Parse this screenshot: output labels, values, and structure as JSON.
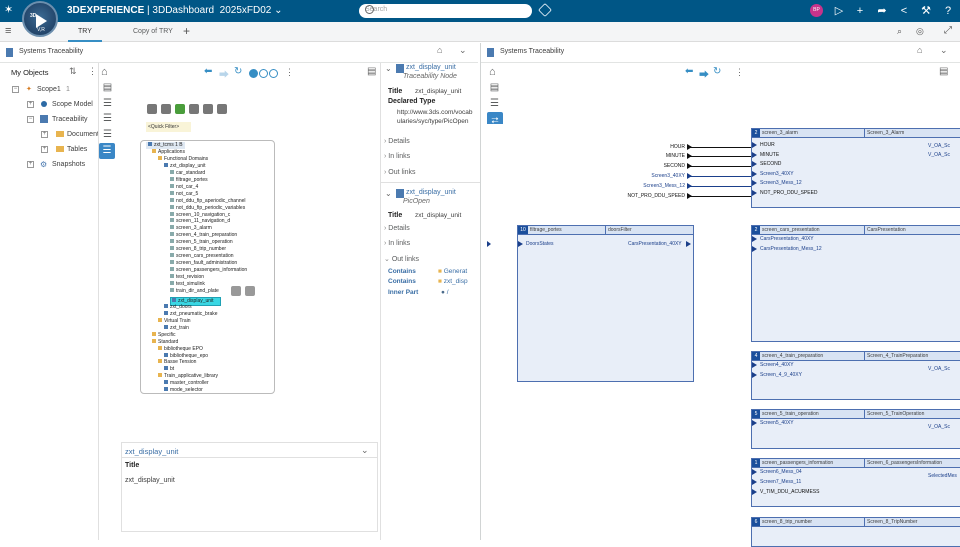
{
  "app": {
    "brand_bold": "3DEXPERIENCE",
    "brand_rest": " | 3DDashboard",
    "dashboard_name": "2025xFD02",
    "compass_label": "3D",
    "compass_version": "V,R",
    "search_placeholder": "Search",
    "avatar_initials": "BP"
  },
  "tabs": [
    "TRY",
    "Copy of TRY"
  ],
  "left_panel": {
    "title": "Systems Traceability",
    "my_objects": "My Objects",
    "scope": "Scope1",
    "scope_count": "1",
    "scope_items": [
      "Scope Model",
      "Traceability"
    ],
    "traceability_children": [
      "Documents",
      "Tables"
    ],
    "snapshots": "Snapshots",
    "quick_filter": "<Quick Filter>",
    "tree_nodes": [
      "zxt_tcms 1 B",
      "Applications",
      "Functional Domains",
      "zxt_display_unit",
      "car_standard",
      "filtrage_portes",
      "not_car_4",
      "not_car_5",
      "not_ddu_fip_aperiodic_channel",
      "not_ddu_fip_periodic_variables",
      "screen_10_navigation_c",
      "screen_11_navigation_d",
      "screen_3_alarm",
      "screen_4_train_preparation",
      "screen_5_train_operation",
      "screen_8_trip_number",
      "screen_cars_presentation",
      "screen_fault_administration",
      "screen_passengers_information",
      "test_revision",
      "test_simulink",
      "train_dir_and_plate",
      "zxt_display_unit",
      "zxt_doors",
      "zxt_pneumatic_brake",
      "Virtual Train",
      "zxt_train",
      "Specific",
      "Standard",
      "bibliotheque EPO",
      "bibliotheque_epo",
      "Basse Tension",
      "bt",
      "Train_applicative_library",
      "master_controller",
      "mode_selector"
    ],
    "bottom_title": "zxt_display_unit",
    "bottom_field": "Title",
    "bottom_value": "zxt_display_unit"
  },
  "details": {
    "card1_name": "zxt_display_unit",
    "card1_type": "Traceability Node",
    "title_label": "Title",
    "title_value": "zxt_display_unit",
    "declared_type_label": "Declared Type",
    "declared_type_value": "http://www.3ds.com/vocabularies/syc/type/PicOpen",
    "sections": [
      "Details",
      "In links",
      "Out links"
    ],
    "card2_name": "zxt_display_unit",
    "card2_type": "PicOpen",
    "card2_title_label": "Title",
    "card2_title_value": "zxt_display_unit",
    "out_links": [
      {
        "rel": "Contains",
        "target": "Generat"
      },
      {
        "rel": "Contains",
        "target": "zxt_disp"
      },
      {
        "rel": "Inner Part",
        "target": "/"
      }
    ]
  },
  "right_panel": {
    "title": "Systems Traceability",
    "input_signals": [
      "HOUR",
      "MINUTE",
      "SECOND",
      "Screen3_40XY",
      "Screen3_Mess_12",
      "NOT_PRO_DDU_SPEED"
    ],
    "blocks": [
      {
        "num": "2",
        "name": "screen_3_alarm",
        "type": "Screen_3_Alarm",
        "inputs": [
          "HOUR",
          "MINUTE",
          "SECOND",
          "Screen3_40XY",
          "Screen3_Mess_12",
          "NOT_PRO_DDU_SPEED"
        ],
        "outputs": [
          "V_OA_Sc",
          "V_OA_Sc"
        ]
      },
      {
        "num": "2",
        "name": "screen_cars_presentation",
        "type": "CarsPresentation",
        "inputs": [
          "CarsPresentation_40XY",
          "CarsPresentation_Mess_12"
        ],
        "outputs": []
      },
      {
        "num": "4",
        "name": "screen_4_train_preparation",
        "type": "Screen_4_TrainPreparation",
        "inputs": [
          "Screen4_40XY",
          "Screen_4_9_40XY"
        ],
        "outputs": [
          "V_OA_Sc"
        ]
      },
      {
        "num": "5",
        "name": "screen_5_train_operation",
        "type": "Screen_5_TrainOperation",
        "inputs": [
          "Screen5_40XY"
        ],
        "outputs": [
          "V_OA_Sc"
        ]
      },
      {
        "num": "1",
        "name": "screen_passengers_information",
        "type": "Screen_6_passengersInformation",
        "inputs": [
          "Screen6_Mess_04",
          "Screen7_Mess_11",
          "V_TIM_DDU_ACURMESS"
        ],
        "outputs": [
          "SelectedMes"
        ]
      },
      {
        "num": "6",
        "name": "screen_8_trip_number",
        "type": "Screen_8_TripNumber",
        "inputs": [],
        "outputs": []
      }
    ],
    "filter_block": {
      "num": "10",
      "name": "filtrage_portes",
      "type": "doorsFilter",
      "input": "DoorsStates",
      "output": "CarsPresentation_40XY"
    }
  }
}
